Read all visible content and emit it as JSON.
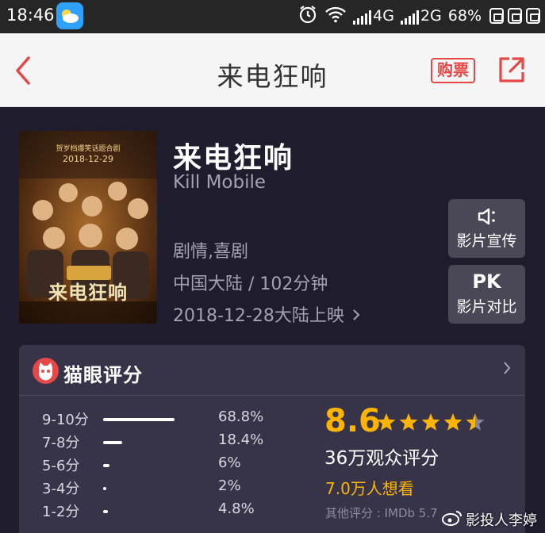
{
  "status_bar": {
    "time": "18:46",
    "network1": "4G",
    "network2": "2G",
    "battery": "68%",
    "icons": [
      "weather-app-icon",
      "alarm-icon",
      "wifi-icon",
      "signal-icon",
      "signal-icon",
      "notification-icon"
    ]
  },
  "nav": {
    "title": "来电狂响",
    "buy_label": "购票",
    "back_icon": "chevron-left-icon",
    "share_icon": "share-icon",
    "accent_color": "#e54847"
  },
  "movie": {
    "title": "来电狂响",
    "english_title": "Kill Mobile",
    "genres": "剧情,喜剧",
    "region_duration": "中国大陆 / 102分钟",
    "release": "2018-12-28大陆上映",
    "poster": {
      "badge": "贺岁档爆笑话题合剧",
      "date": "2018-12-29",
      "title": "来电狂响"
    }
  },
  "actions": {
    "trailer_label": "影片宣传",
    "compare_glyph": "PK",
    "compare_label": "影片对比"
  },
  "rating": {
    "header": "猫眼评分",
    "score": "8.6",
    "stars": 4.5,
    "votes": "36万观众评分",
    "want_to_see": "7.0万人想看",
    "other_ratings": "其他评分 : IMDb 5.7",
    "score_color": "#ffb400",
    "distribution": [
      {
        "label": "9-10分",
        "percent_text": "68.8%",
        "fill": 0.688
      },
      {
        "label": "7-8分",
        "percent_text": "18.4%",
        "fill": 0.184
      },
      {
        "label": "5-6分",
        "percent_text": "6%",
        "fill": 0.06
      },
      {
        "label": "3-4分",
        "percent_text": "2%",
        "fill": 0.02
      },
      {
        "label": "1-2分",
        "percent_text": "4.8%",
        "fill": 0.048
      }
    ]
  },
  "watermark": {
    "text": "影投人李婷",
    "icon": "weibo-icon"
  }
}
